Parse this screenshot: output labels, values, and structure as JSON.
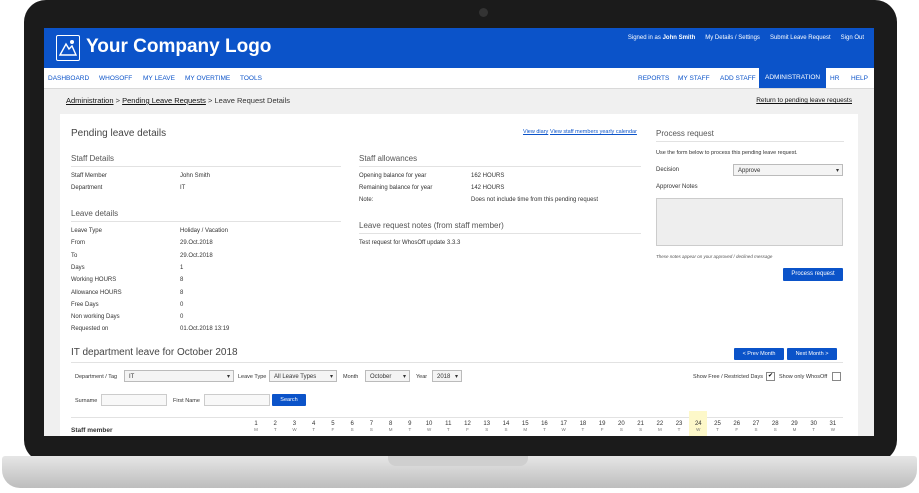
{
  "header": {
    "logo_text": "Your Company Logo",
    "signed_in_prefix": "Signed in as",
    "signed_in_user": "John Smith",
    "links": [
      "My Details / Settings",
      "Submit Leave Request",
      "Sign Out"
    ]
  },
  "nav": {
    "left": [
      "DASHBOARD",
      "WHOSOFF",
      "MY LEAVE",
      "MY OVERTIME",
      "TOOLS"
    ],
    "right": [
      "REPORTS",
      "MY STAFF",
      "ADD STAFF",
      "ADMINISTRATION",
      "HR",
      "HELP"
    ],
    "active": "ADMINISTRATION"
  },
  "breadcrumb": {
    "part1": "Administration",
    "part2": "Pending Leave Requests",
    "part3": "Leave Request Details",
    "sep": ">",
    "return_link": "Return to pending leave requests"
  },
  "pending": {
    "title": "Pending leave details",
    "view_diary": "View diary",
    "view_yearly": "View staff members yearly calendar",
    "staff_details_title": "Staff Details",
    "staff_member_label": "Staff Member",
    "staff_member_value": "John Smith",
    "department_label": "Department",
    "department_value": "IT",
    "leave_details_title": "Leave details",
    "leave_rows": [
      {
        "label": "Leave Type",
        "value": "Holiday / Vacation"
      },
      {
        "label": "From",
        "value": "29.Oct.2018"
      },
      {
        "label": "To",
        "value": "29.Oct.2018"
      },
      {
        "label": "Days",
        "value": "1"
      },
      {
        "label": "Working HOURS",
        "value": "8"
      },
      {
        "label": "Allowance HOURS",
        "value": "8"
      },
      {
        "label": "Free Days",
        "value": "0"
      },
      {
        "label": "Non working Days",
        "value": "0"
      },
      {
        "label": "Requested on",
        "value": "01.Oct.2018 13:19"
      }
    ],
    "allowances_title": "Staff allowances",
    "allowance_rows": [
      {
        "label": "Opening balance for year",
        "value": "162 HOURS"
      },
      {
        "label": "Remaining balance for year",
        "value": "142 HOURS"
      },
      {
        "label": "Note:",
        "value": "Does not include time from this pending request"
      }
    ],
    "notes_title": "Leave request notes (from staff member)",
    "notes_text": "Test request for WhosOff update 3.3.3"
  },
  "process": {
    "title": "Process request",
    "instructions": "Use the form below to process this pending leave request.",
    "decision_label": "Decision",
    "decision_value": "Approve",
    "approver_notes_label": "Approver Notes",
    "notes_hint": "These notes appear on your approved / declined message",
    "button": "Process request"
  },
  "dept_leave": {
    "title": "IT department leave for October 2018",
    "prev_btn": "< Prev Month",
    "next_btn": "Next Month >",
    "dept_label": "Department / Tag",
    "dept_value": "IT",
    "leave_type_label": "Leave Type",
    "leave_type_value": "All Leave Types",
    "month_label": "Month",
    "month_value": "October",
    "year_label": "Year",
    "year_value": "2018",
    "show_free_label": "Show Free / Restricted Days",
    "show_free_checked": "✔",
    "show_whosoff_label": "Show only WhosOff",
    "surname_label": "Surname",
    "firstname_label": "First Name",
    "search_btn": "Search",
    "staff_member_col": "Staff member",
    "days": [
      {
        "n": "1",
        "d": "M"
      },
      {
        "n": "2",
        "d": "T"
      },
      {
        "n": "3",
        "d": "W"
      },
      {
        "n": "4",
        "d": "T"
      },
      {
        "n": "5",
        "d": "F"
      },
      {
        "n": "6",
        "d": "S"
      },
      {
        "n": "7",
        "d": "S"
      },
      {
        "n": "8",
        "d": "M"
      },
      {
        "n": "9",
        "d": "T"
      },
      {
        "n": "10",
        "d": "W"
      },
      {
        "n": "11",
        "d": "T"
      },
      {
        "n": "12",
        "d": "F"
      },
      {
        "n": "13",
        "d": "S"
      },
      {
        "n": "14",
        "d": "S"
      },
      {
        "n": "15",
        "d": "M"
      },
      {
        "n": "16",
        "d": "T"
      },
      {
        "n": "17",
        "d": "W"
      },
      {
        "n": "18",
        "d": "T"
      },
      {
        "n": "19",
        "d": "F"
      },
      {
        "n": "20",
        "d": "S"
      },
      {
        "n": "21",
        "d": "S"
      },
      {
        "n": "22",
        "d": "M"
      },
      {
        "n": "23",
        "d": "T"
      },
      {
        "n": "24",
        "d": "W"
      },
      {
        "n": "25",
        "d": "T"
      },
      {
        "n": "26",
        "d": "F"
      },
      {
        "n": "27",
        "d": "S"
      },
      {
        "n": "28",
        "d": "S"
      },
      {
        "n": "29",
        "d": "M"
      },
      {
        "n": "30",
        "d": "T"
      },
      {
        "n": "31",
        "d": "W"
      }
    ],
    "highlight_day": "24"
  },
  "colors": {
    "brand": "#0b53c9",
    "highlight": "#fdf8c9"
  }
}
